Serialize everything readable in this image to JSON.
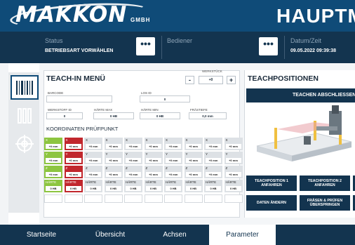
{
  "header": {
    "brand": "MAKKON",
    "brand_suffix": "GMBH",
    "title": "HAUPTM"
  },
  "status_bar": {
    "status_label": "Status",
    "status_value": "BETRIEBSART VORWÄHLEN",
    "operator_label": "Bediener",
    "operator_value": "",
    "datetime_label": "Datum/Zeit",
    "datetime_value": "09.05.2022 09:39:38",
    "more_button": "•••"
  },
  "tools": [
    "barcode-icon",
    "tools-icon",
    "target-icon"
  ],
  "teach_in": {
    "title": "TEACH-IN MENÜ",
    "werkstueck_label": "WERKSTÜCK",
    "werkstueck_value": "+0",
    "minus": "-",
    "plus": "+",
    "barcode_label": "BARCODE",
    "barcode_value": "",
    "los_id_label": "LOS ID",
    "los_id_value": "0",
    "werkstoff_label": "WERKSTOFF ID",
    "werkstoff_value": "0",
    "haerte_max_label": "HÄRTE MAX",
    "haerte_max_value": "0 HB",
    "haerte_min_label": "HÄRTE MIN",
    "haerte_min_value": "0 HB",
    "fraestiefe_label": "FRÄSTIEFE",
    "fraestiefe_value": "0,0 mm",
    "koordinaten_title": "KOORDINATEN PRÜFPUNKT",
    "columns": [
      {
        "x": "+0 mm",
        "y": "+0 mm",
        "z": "+0 mm",
        "h": "0 HB",
        "state": "green"
      },
      {
        "x": "+0 mm",
        "y": "+0 mm",
        "z": "+0 mm",
        "h": "0 HB",
        "state": "red"
      },
      {
        "x": "+0 mm",
        "y": "+0 mm",
        "z": "+0 mm",
        "h": "0 HB",
        "state": "none"
      },
      {
        "x": "+0 mm",
        "y": "+0 mm",
        "z": "+0 mm",
        "h": "0 HB",
        "state": "none"
      },
      {
        "x": "+0 mm",
        "y": "+0 mm",
        "z": "+0 mm",
        "h": "0 HB",
        "state": "none"
      },
      {
        "x": "+0 mm",
        "y": "+0 mm",
        "z": "+0 mm",
        "h": "0 HB",
        "state": "none"
      },
      {
        "x": "+0 mm",
        "y": "+0 mm",
        "z": "+0 mm",
        "h": "0 HB",
        "state": "none"
      },
      {
        "x": "+0 mm",
        "y": "+0 mm",
        "z": "+0 mm",
        "h": "0 HB",
        "state": "none"
      },
      {
        "x": "+0 mm",
        "y": "+0 mm",
        "z": "+0 mm",
        "h": "0 HB",
        "state": "none"
      },
      {
        "x": "+0 mm",
        "y": "+0 mm",
        "z": "+0 mm",
        "h": "0 HB",
        "state": "none"
      }
    ],
    "row_labels": {
      "x": "X",
      "y": "Y",
      "z": "Z",
      "h": "HÄRTE"
    }
  },
  "teachpositionen": {
    "title": "TEACHPOSITIONEN",
    "teach_button": "TEACHEN ABSCHLIESSEN",
    "buttons": [
      "TEACHPOSITION 1 ANFAHREN",
      "TEACHPOSITION 2 ANFAHREN",
      "DATEN ÄNDERN",
      "FRÄSEN & PRÜFEN ÜBERSPRINGEN"
    ]
  },
  "nav": {
    "items": [
      "Startseite",
      "Übersicht",
      "Achsen",
      "Parameter"
    ],
    "active": "Parameter"
  },
  "colors": {
    "header_blue": "#0f4b78",
    "dark_navy": "#13344f",
    "green": "#8dc540",
    "red": "#c1272d"
  }
}
